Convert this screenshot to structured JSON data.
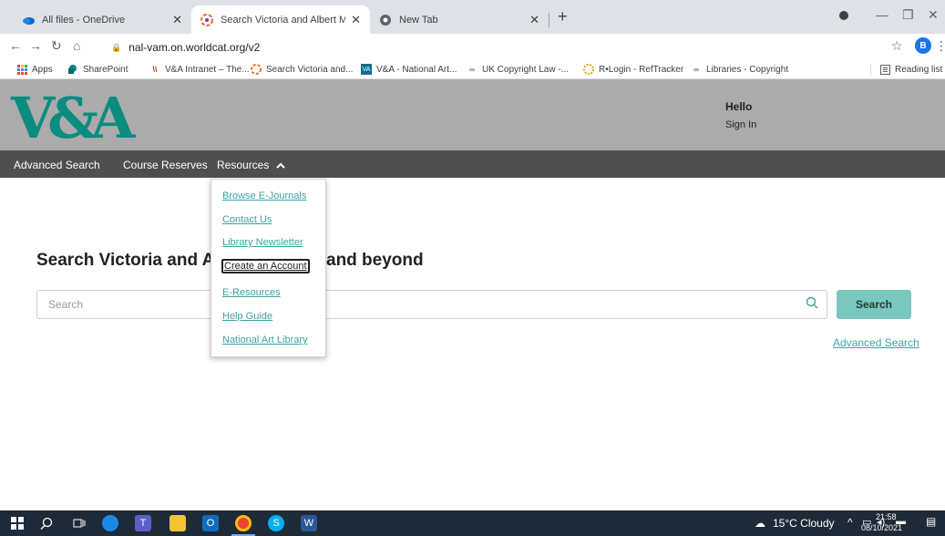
{
  "browser": {
    "tabs": [
      {
        "title": "All files - OneDrive",
        "icon": "onedrive-icon"
      },
      {
        "title": "Search Victoria and Albert Muse",
        "icon": "worldcat-icon"
      },
      {
        "title": "New Tab",
        "icon": "chrome-icon"
      }
    ],
    "url": "nal-vam.on.worldcat.org/v2",
    "profile_initial": "B",
    "bookmarks": [
      {
        "label": "Apps",
        "icon": "apps-grid-icon"
      },
      {
        "label": "SharePoint",
        "icon": "sharepoint-icon"
      },
      {
        "label": "V&A Intranet – The...",
        "icon": "va-intranet-icon"
      },
      {
        "label": "Search Victoria and...",
        "icon": "worldcat-icon"
      },
      {
        "label": "V&A - National Art...",
        "icon": "va-nal-icon"
      },
      {
        "label": "UK Copyright Law -...",
        "icon": "link-icon"
      },
      {
        "label": "R•Login - RefTracker",
        "icon": "reftracker-icon"
      },
      {
        "label": "Libraries - Copyright",
        "icon": "link-icon"
      }
    ],
    "reading_list": "Reading list"
  },
  "site": {
    "logo": "V&A",
    "hello": "Hello",
    "sign_in": "Sign In",
    "nav": {
      "advanced_search": "Advanced Search",
      "course_reserves": "Course Reserves",
      "resources": "Resources"
    },
    "heading_start": "Search Victoria and Al",
    "heading_end": "and beyond",
    "search_placeholder": "Search",
    "search_button": "Search",
    "advanced_search_link": "Advanced Search",
    "resources_menu": [
      "Browse E-Journals",
      "Contact Us",
      "Library Newsletter",
      "Create an Account",
      "E-Resources",
      "Help Guide",
      "National Art Library"
    ],
    "focused_menu_item": "Create an Account"
  },
  "taskbar": {
    "weather": "15°C  Cloudy",
    "time": "21:58",
    "date": "08/10/2021"
  },
  "colors": {
    "brand_teal": "#0b8c80",
    "link_teal": "#3aa6a0",
    "search_button": "#7ac7bd",
    "header_grey": "#ababab",
    "nav_dark": "#4f4f4f",
    "taskbar": "#1f2a38"
  }
}
